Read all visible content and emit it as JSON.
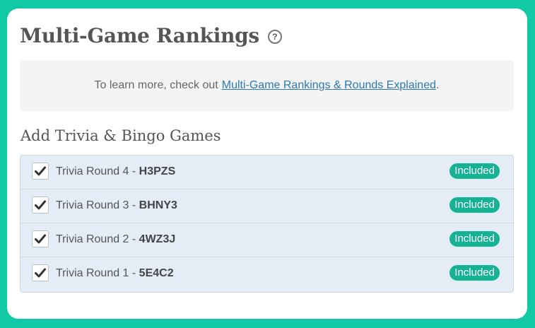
{
  "header": {
    "title": "Multi-Game Rankings",
    "help_icon": "question-mark-icon"
  },
  "info": {
    "prefix": "To learn more, check out",
    "link_text": "Multi-Game Rankings & Rounds Explained",
    "suffix": "."
  },
  "section": {
    "title": "Add Trivia & Bingo Games"
  },
  "games": [
    {
      "name": "Trivia Round 4 - ",
      "code": "H3PZS",
      "checked": true,
      "badge": "Included"
    },
    {
      "name": "Trivia Round 3 - ",
      "code": "BHNY3",
      "checked": true,
      "badge": "Included"
    },
    {
      "name": "Trivia Round 2 - ",
      "code": "4WZ3J",
      "checked": true,
      "badge": "Included"
    },
    {
      "name": "Trivia Round 1 - ",
      "code": "5E4C2",
      "checked": true,
      "badge": "Included"
    }
  ],
  "colors": {
    "background": "#12c9a6",
    "badge": "#13b394",
    "link": "#2a7ab5",
    "list_background": "#e4edf5"
  }
}
